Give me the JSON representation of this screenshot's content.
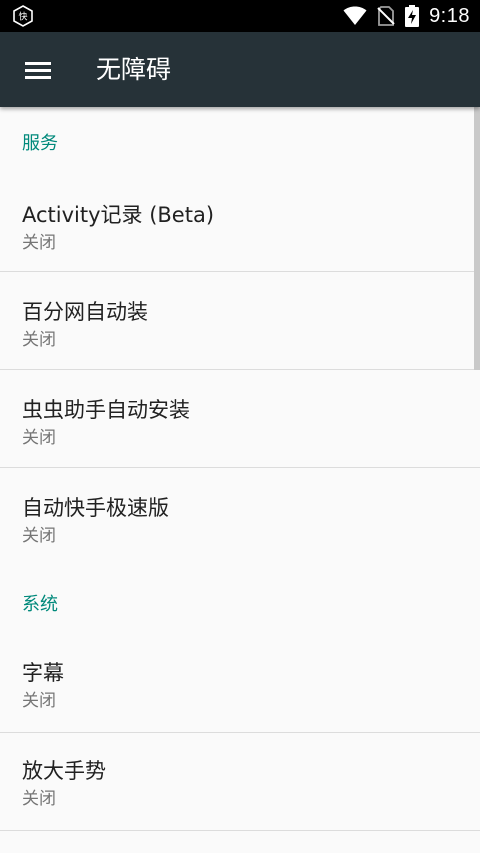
{
  "status_bar": {
    "time": "9:18",
    "icons": [
      "app-notification-icon",
      "wifi-icon",
      "no-sim-icon",
      "battery-charging-icon"
    ],
    "notification_glyph": "快"
  },
  "app_bar": {
    "title": "无障碍",
    "menu_icon": "menu-icon",
    "background": "#263238"
  },
  "accent_color": "#00897b",
  "sections": [
    {
      "header": "服务",
      "items": [
        {
          "title": "Activity记录 (Beta)",
          "summary": "关闭"
        },
        {
          "title": "百分网自动装",
          "summary": "关闭"
        },
        {
          "title": "虫虫助手自动安装",
          "summary": "关闭"
        },
        {
          "title": "自动快手极速版",
          "summary": "关闭"
        }
      ]
    },
    {
      "header": "系统",
      "items": [
        {
          "title": "字幕",
          "summary": "关闭"
        },
        {
          "title": "放大手势",
          "summary": "关闭"
        }
      ]
    }
  ]
}
